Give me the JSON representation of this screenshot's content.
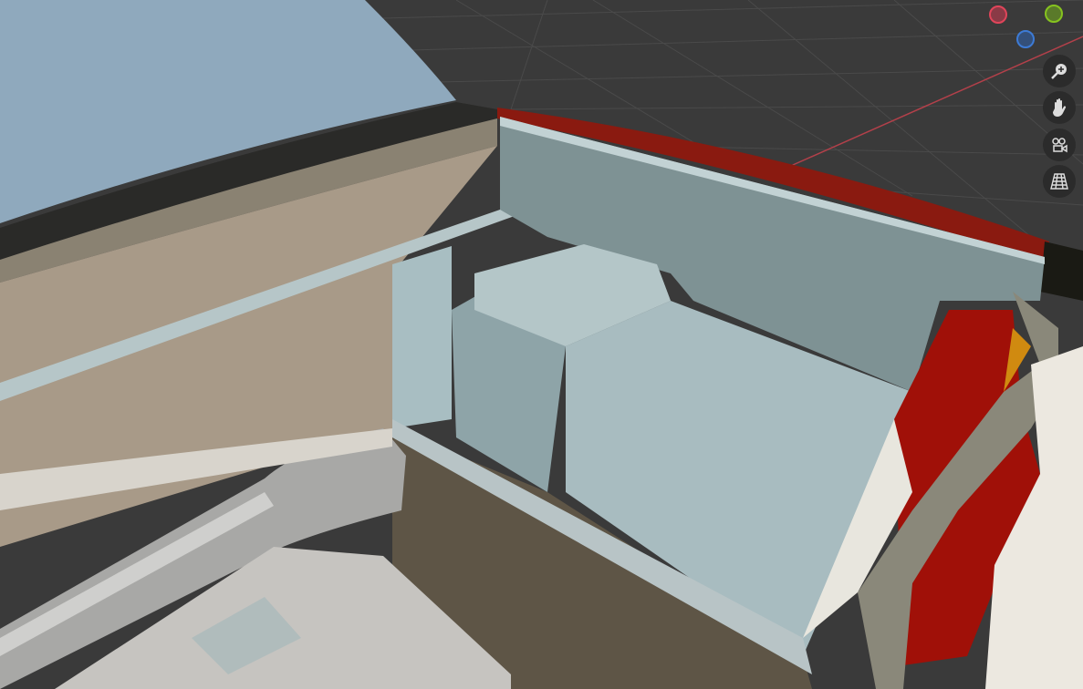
{
  "viewport": {
    "background_color": "#3a3a3a",
    "grid_line_color": "#4a4a4a",
    "x_axis_color": "#b3404a"
  },
  "gizmo": {
    "x_negative_color": "#e0455a",
    "y_negative_color": "#86c31f",
    "z_negative_color": "#3d7bd6"
  },
  "nav_buttons": [
    {
      "icon": "zoom-icon"
    },
    {
      "icon": "hand-pan-icon"
    },
    {
      "icon": "camera-view-icon"
    },
    {
      "icon": "perspective-grid-icon"
    }
  ]
}
